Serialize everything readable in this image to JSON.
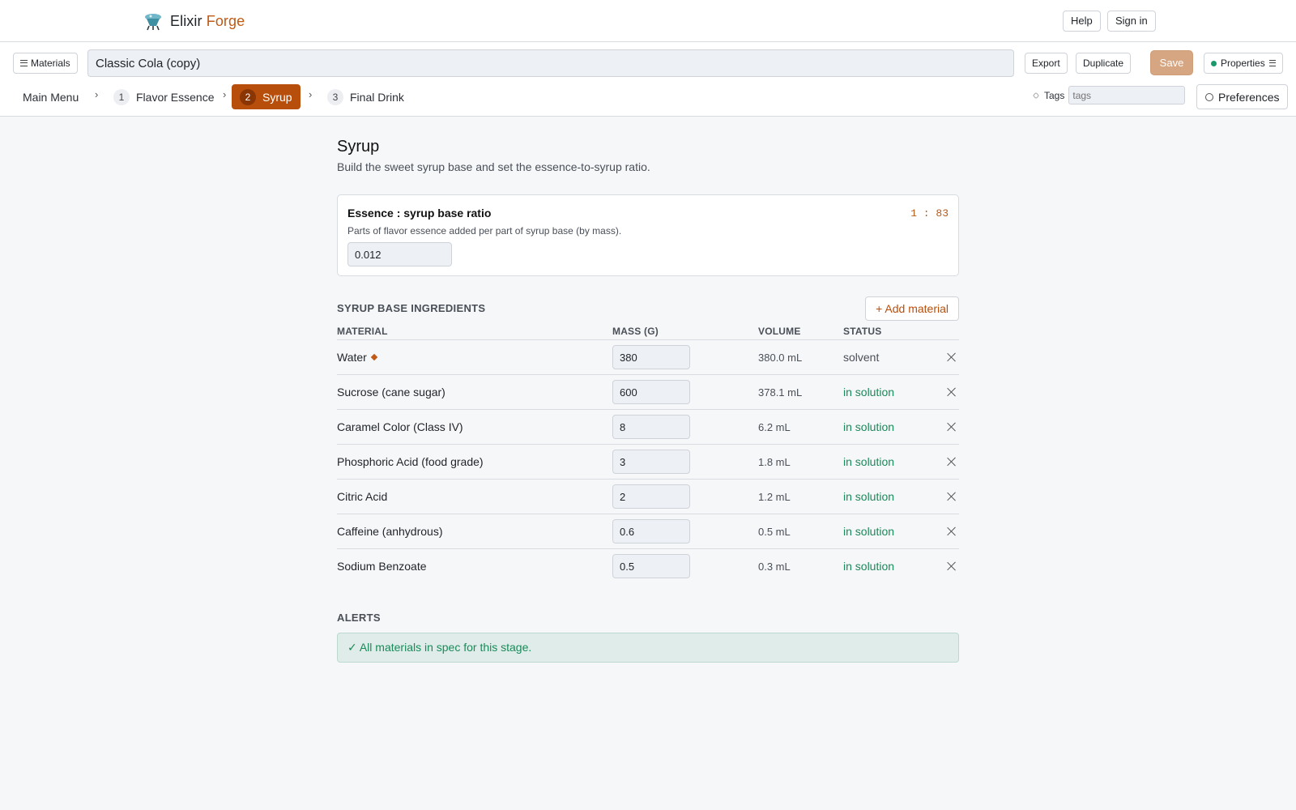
{
  "app": {
    "brand_name": "Elixir",
    "brand_accent": "Forge",
    "help_label": "Help",
    "signin_label": "Sign in"
  },
  "toolbar": {
    "materials_label": "Materials",
    "title_value": "Classic Cola (copy)",
    "export_label": "Export",
    "duplicate_label": "Duplicate",
    "save_label": "Save",
    "properties_label": "Properties"
  },
  "steps": {
    "main_menu": "Main Menu",
    "items": [
      {
        "num": "1",
        "label": "Flavor Essence",
        "active": false
      },
      {
        "num": "2",
        "label": "Syrup",
        "active": true
      },
      {
        "num": "3",
        "label": "Final Drink",
        "active": false
      }
    ],
    "tags_label": "Tags",
    "tags_placeholder": "tags",
    "preferences_label": "Preferences"
  },
  "page": {
    "title": "Syrup",
    "subtitle": "Build the sweet syrup base and set the essence-to-syrup ratio."
  },
  "ratio": {
    "title": "Essence : syrup base ratio",
    "description": "Parts of flavor essence added per part of syrup base (by mass).",
    "value": "0.012",
    "readout": "1 : 83"
  },
  "ingredients": {
    "heading": "SYRUP BASE INGREDIENTS",
    "add_label": "+ Add material",
    "columns": {
      "material": "MATERIAL",
      "mass": "MASS (G)",
      "volume": "VOLUME",
      "status": "STATUS"
    },
    "rows": [
      {
        "material": "Water",
        "mass": "380",
        "volume": "380.0 mL",
        "status": "solvent",
        "marked": true
      },
      {
        "material": "Sucrose (cane sugar)",
        "mass": "600",
        "volume": "378.1 mL",
        "status": "in solution"
      },
      {
        "material": "Caramel Color (Class IV)",
        "mass": "8",
        "volume": "6.2 mL",
        "status": "in solution"
      },
      {
        "material": "Phosphoric Acid (food grade)",
        "mass": "3",
        "volume": "1.8 mL",
        "status": "in solution"
      },
      {
        "material": "Citric Acid",
        "mass": "2",
        "volume": "1.2 mL",
        "status": "in solution"
      },
      {
        "material": "Caffeine (anhydrous)",
        "mass": "0.6",
        "volume": "0.5 mL",
        "status": "in solution"
      },
      {
        "material": "Sodium Benzoate",
        "mass": "0.5",
        "volume": "0.3 mL",
        "status": "in solution"
      }
    ]
  },
  "alerts": {
    "heading": "ALERTS",
    "message": "✓ All materials in spec for this stage."
  },
  "colors": {
    "accent": "#b84e0b",
    "save_disabled": "#d6a582",
    "status_ok": "#1a8a5a",
    "alert_bg": "#dfece9"
  },
  "icons": {
    "brand": "flask-logo-icon",
    "materials": "hamburger-icon",
    "properties": "list-icon",
    "tags": "tag-icon",
    "preferences": "gear-icon",
    "remove": "close-icon",
    "primary_solvent": "diamond-icon"
  }
}
